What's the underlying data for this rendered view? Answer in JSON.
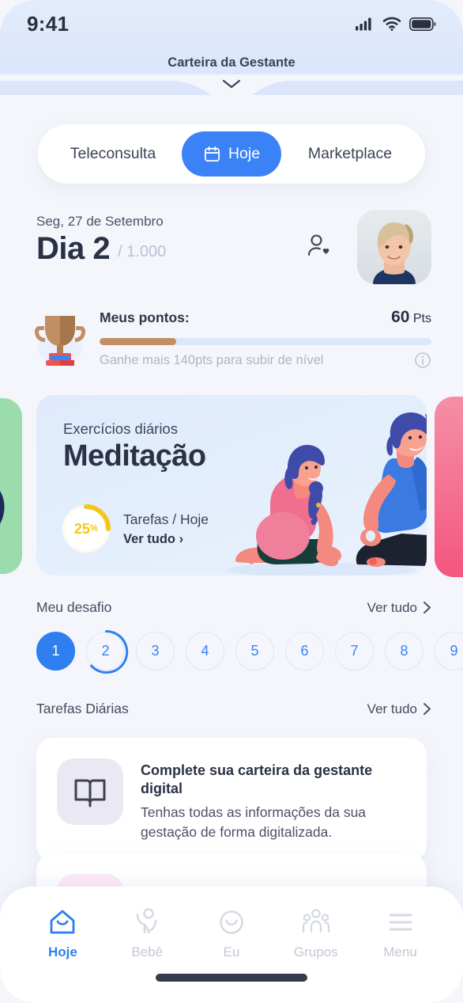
{
  "status_bar": {
    "time": "9:41",
    "signal_icon": "cellular-signal-icon",
    "wifi_icon": "wifi-icon",
    "battery_icon": "battery-icon"
  },
  "header": {
    "title": "Carteira da Gestante",
    "collapse_icon": "chevron-down-icon"
  },
  "tabs": [
    {
      "label": "Teleconsulta",
      "active": false,
      "icon": null
    },
    {
      "label": "Hoje",
      "active": true,
      "icon": "calendar-icon"
    },
    {
      "label": "Marketplace",
      "active": false,
      "icon": null
    }
  ],
  "day_header": {
    "date": "Seg, 27 de Setembro",
    "day_label": "Dia 2",
    "day_total": "/ 1.000",
    "profile_icon": "person-heart-icon",
    "bell_icon": "bell-icon",
    "avatar_alt": "avatar"
  },
  "points": {
    "trophy_icon": "trophy-icon",
    "label": "Meus pontos:",
    "value": "60",
    "unit": "Pts",
    "progress_percent": 23,
    "hint": "Ganhe mais 140pts para subir de nível",
    "info_icon": "info-icon",
    "fill_color": "#c08f63",
    "track_color": "#dbe7fb"
  },
  "meditation_card": {
    "kicker": "Exercícios diários",
    "title": "Meditação",
    "percent_label": "25",
    "percent_symbol": "%",
    "percent_value": 25,
    "tasks_label": "Tarefas / Hoje",
    "see_all": "Ver tudo",
    "chevron_icon": "chevron-right-icon",
    "accent_color": "#f7c51a",
    "card_color": "#e3eefc",
    "peek_left_color": "#8fd6a4",
    "peek_right_color": "#f4567f"
  },
  "challenge": {
    "title": "Meu desafio",
    "see_all": "Ver tudo",
    "chevron_icon": "chevron-right-icon",
    "days": [
      {
        "n": "1",
        "state": "done"
      },
      {
        "n": "2",
        "state": "current"
      },
      {
        "n": "3",
        "state": "upcoming"
      },
      {
        "n": "4",
        "state": "upcoming"
      },
      {
        "n": "5",
        "state": "upcoming"
      },
      {
        "n": "6",
        "state": "upcoming"
      },
      {
        "n": "7",
        "state": "upcoming"
      },
      {
        "n": "8",
        "state": "upcoming"
      },
      {
        "n": "9",
        "state": "upcoming"
      }
    ]
  },
  "daily_tasks": {
    "title": "Tarefas Diárias",
    "see_all": "Ver tudo",
    "chevron_icon": "chevron-right-icon",
    "cards": [
      {
        "icon": "book-icon",
        "icon_tone": "purple",
        "title": "Complete sua carteira da gestante digital",
        "desc": "Tenhas todas as informações da sua gestação de forma digitalizada."
      },
      {
        "icon": "heart-icon",
        "icon_tone": "pink",
        "title": "",
        "desc": ""
      }
    ]
  },
  "bottom_nav": {
    "items": [
      {
        "label": "Hoje",
        "icon": "home-icon",
        "active": true
      },
      {
        "label": "Bebê",
        "icon": "baby-icon",
        "active": false
      },
      {
        "label": "Eu",
        "icon": "smiley-icon",
        "active": false
      },
      {
        "label": "Grupos",
        "icon": "group-icon",
        "active": false
      },
      {
        "label": "Menu",
        "icon": "hamburger-icon",
        "active": false
      }
    ],
    "active_color": "#2f7ff0",
    "inactive_color": "#c3c8d4"
  }
}
